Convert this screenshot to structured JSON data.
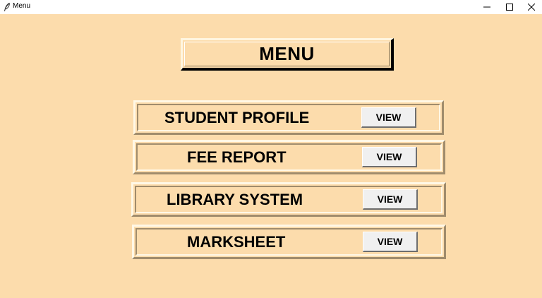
{
  "window": {
    "title": "Menu",
    "icon": "feather-icon",
    "controls": {
      "minimize": "minimize-icon",
      "maximize": "maximize-icon",
      "close": "close-icon"
    }
  },
  "header": {
    "title": "MENU"
  },
  "menu": {
    "items": [
      {
        "label": "STUDENT PROFILE",
        "button": "VIEW"
      },
      {
        "label": "FEE REPORT",
        "button": "VIEW"
      },
      {
        "label": "LIBRARY SYSTEM",
        "button": "VIEW"
      },
      {
        "label": "MARKSHEET",
        "button": "VIEW"
      }
    ]
  },
  "colors": {
    "background": "#fcdcac",
    "button": "#f0f0f0",
    "text": "#000000"
  }
}
